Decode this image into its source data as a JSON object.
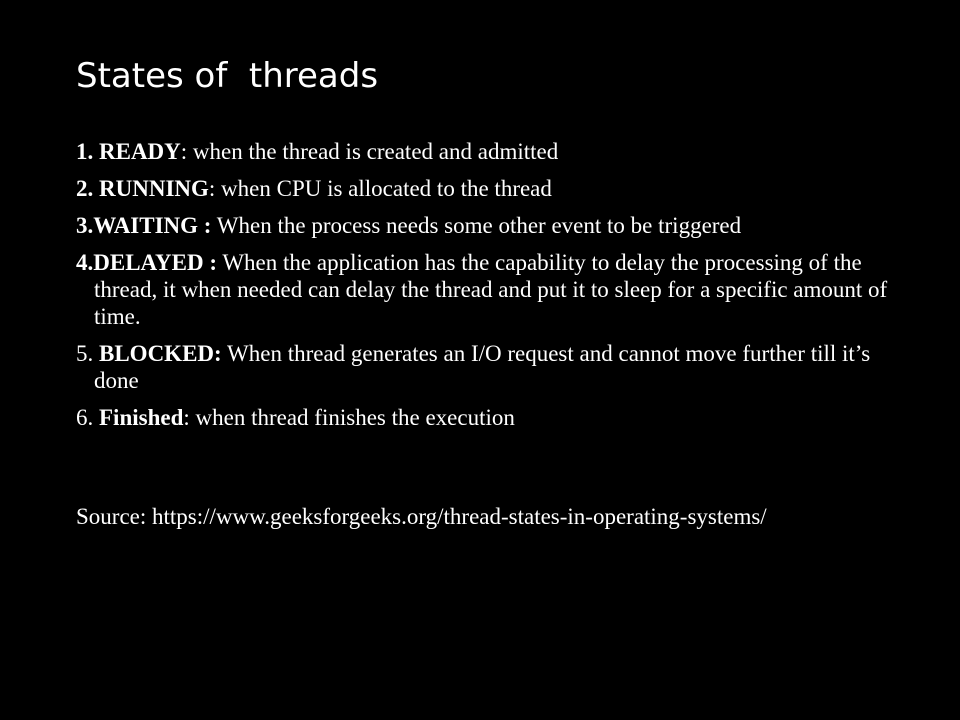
{
  "slide": {
    "title": "States of  threads",
    "items": [
      {
        "number": "1. ",
        "state": "READY",
        "desc": ": when the thread is created and admitted"
      },
      {
        "number": "2. ",
        "state": "RUNNING",
        "desc": ": when CPU is allocated to the thread"
      },
      {
        "number": "3.",
        "state": "WAITING :",
        "desc": " When the process needs some other event to be triggered"
      },
      {
        "number": "4.",
        "state": "DELAYED :",
        "desc": " When the application has the capability to delay the processing of the thread, it when needed can delay the thread and put it to sleep for a specific amount of time."
      },
      {
        "number": "5. ",
        "state": "BLOCKED:",
        "desc": " When thread generates an I/O request and cannot move further till it’s done"
      },
      {
        "number": "6. ",
        "state": "Finished",
        "desc": ": when thread finishes the execution"
      }
    ],
    "source": "Source: https://www.geeksforgeeks.org/thread-states-in-operating-systems/"
  }
}
